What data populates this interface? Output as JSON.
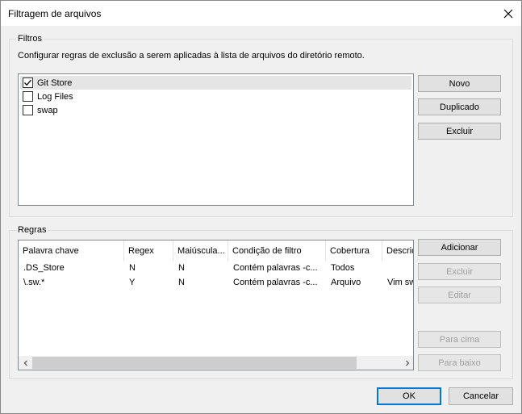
{
  "window": {
    "title": "Filtragem de arquivos",
    "close_icon": "close-icon"
  },
  "filters": {
    "group_label": "Filtros",
    "description": "Configurar regras de exclusão a serem aplicadas à lista de arquivos do diretório remoto.",
    "items": [
      {
        "label": "Git Store",
        "checked": true
      },
      {
        "label": "Log Files",
        "checked": false
      },
      {
        "label": "swap",
        "checked": false
      }
    ],
    "buttons": {
      "new": "Novo",
      "duplicate": "Duplicado",
      "delete": "Excluir"
    }
  },
  "rules": {
    "group_label": "Regras",
    "columns": [
      "Palavra chave",
      "Regex",
      "Maiúscula...",
      "Condição de filtro",
      "Cobertura",
      "Descriç"
    ],
    "rows": [
      [
        ".DS_Store",
        "N",
        "N",
        "Contém palavras -c...",
        "Todos",
        ""
      ],
      [
        "\\.sw.*",
        "Y",
        "N",
        "Contém palavras -c...",
        "Arquivo",
        "Vim sw"
      ]
    ],
    "buttons": {
      "add": "Adicionar",
      "delete": "Excluir",
      "edit": "Editar",
      "up": "Para cima",
      "down": "Para baixo"
    }
  },
  "footer": {
    "ok": "OK",
    "cancel": "Cancelar"
  }
}
